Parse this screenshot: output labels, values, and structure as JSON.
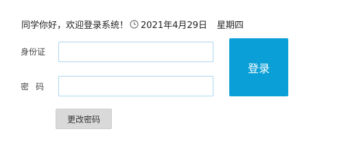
{
  "header": {
    "welcome_text": "同学你好，欢迎登录系统！",
    "date": "2021年4月29日",
    "weekday": "星期四"
  },
  "form": {
    "id_label": "身份证",
    "id_value": "",
    "password_label": "密码",
    "password_value": ""
  },
  "actions": {
    "login_label": "登录",
    "change_password_label": "更改密码"
  },
  "icons": {
    "clock": "clock-icon"
  },
  "colors": {
    "login_button": "#0a9fd6",
    "input_border": "#a9d7ef",
    "secondary_button": "#d9d9d9"
  }
}
